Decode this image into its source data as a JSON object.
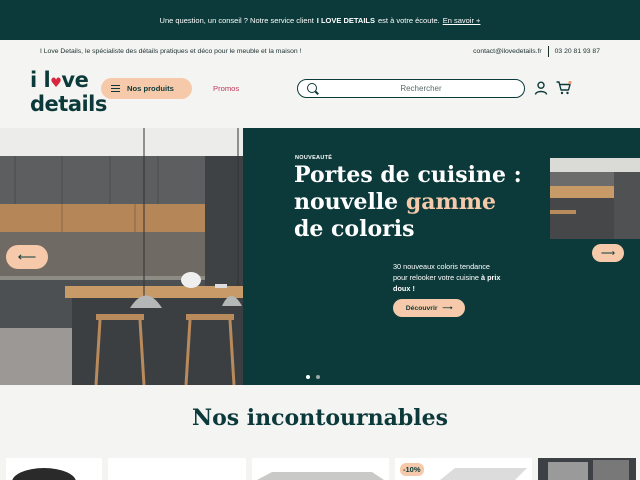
{
  "topbar": {
    "text_before": "Une question, un conseil ? Notre service client",
    "brand": "I LOVE DETAILS",
    "text_after": "est à votre écoute.",
    "link": "En savoir +"
  },
  "infobar": {
    "tagline": "I Love Details, le spécialiste des détails pratiques et déco pour le meuble et la maison !",
    "email": "contact@ilovedetails.fr",
    "phone": "03 20 81 93 87"
  },
  "header": {
    "logo_line1_a": "i l",
    "logo_heart": "♥",
    "logo_line1_b": "ve",
    "logo_line2": "details",
    "products_label": "Nos produits",
    "promos_label": "Promos",
    "search_placeholder": "Rechercher"
  },
  "hero": {
    "tag": "NOUVEAUTÉ",
    "headline_line1": "Portes de cuisine :",
    "headline_line2a": "nouvelle ",
    "headline_line2b": "gamme",
    "headline_line3": "de coloris",
    "desc_text": "30 nouveaux coloris tendance pour relooker votre cuisine ",
    "desc_bold": "à prix doux !",
    "cta_label": "Découvrir",
    "arrow_left": "⟵",
    "arrow_right": "⟶"
  },
  "section": {
    "title": "Nos incontournables",
    "badge": "-10%"
  },
  "colors": {
    "dark_teal": "#0c3a3a",
    "peach": "#f5c9a9",
    "promo_pink": "#c0395a"
  }
}
